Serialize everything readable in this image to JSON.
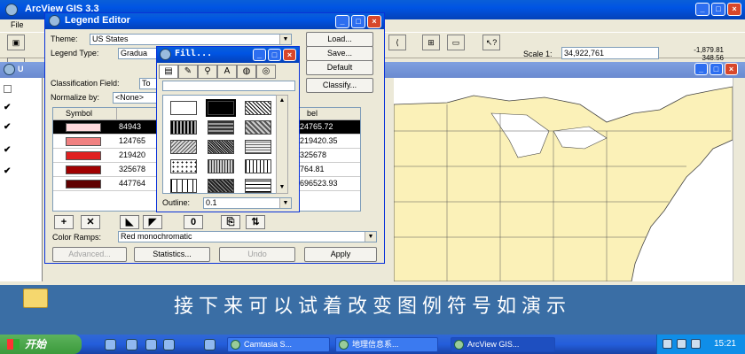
{
  "app": {
    "title": "ArcView GIS 3.3",
    "menu_file": "File",
    "scale_label": "Scale 1:",
    "scale_value": "34,922,761",
    "coord_x": "-1,879.81",
    "coord_y": "348.56",
    "view_title": "U"
  },
  "legend_editor": {
    "title": "Legend Editor",
    "theme_label": "Theme:",
    "theme_value": "US States",
    "legend_type_label": "Legend Type:",
    "legend_type_value": "Gradua",
    "classification_label": "Classification Field:",
    "classification_value": "To",
    "normalize_label": "Normalize by:",
    "normalize_value": "<None>",
    "load_button": "Load...",
    "save_button": "Save...",
    "default_button": "Default",
    "classify_button": "Classify...",
    "symbol_col": "Symbol",
    "label_col": "bel",
    "rows": [
      {
        "value": "84943",
        "label": "24765.72",
        "color": "#ffd9dc"
      },
      {
        "value": "124765",
        "label": "219420.35",
        "color": "#f08080"
      },
      {
        "value": "219420",
        "label": "325678",
        "color": "#e02020"
      },
      {
        "value": "325678",
        "label": "764.81",
        "color": "#a00000"
      },
      {
        "value": "447764",
        "label": "696523.93",
        "color": "#600000"
      }
    ],
    "reverse_label": "0",
    "color_ramps_label": "Color Ramps:",
    "color_ramps_value": "Red monochromatic",
    "advanced_button": "Advanced...",
    "statistics_button": "Statistics...",
    "undo_button": "Undo",
    "apply_button": "Apply"
  },
  "fill_palette": {
    "title": "Fill...",
    "outline_label": "Outline:",
    "outline_value": "0.1"
  },
  "subtitle": "接下来可以试着改变图例符号如演示",
  "taskbar": {
    "start_label": "开始",
    "tasks": [
      {
        "label": "Camtasia S..."
      },
      {
        "label": "地理信息系..."
      },
      {
        "label": "ArcView GIS..."
      }
    ],
    "clock": "15:21"
  }
}
